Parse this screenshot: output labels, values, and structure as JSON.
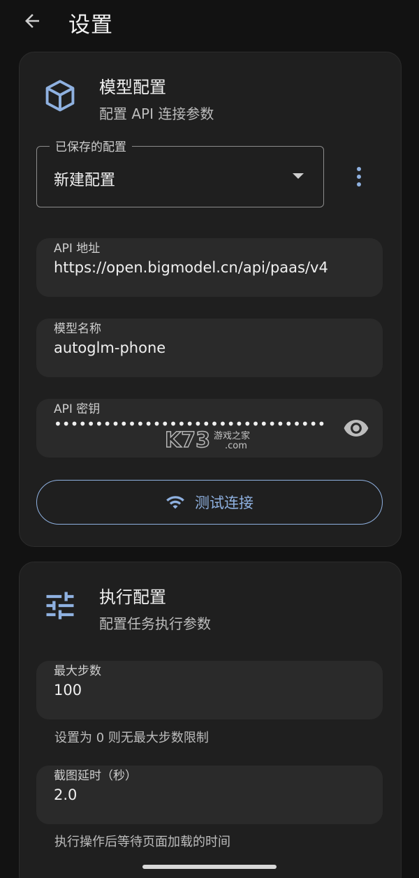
{
  "header": {
    "title": "设置"
  },
  "model_card": {
    "title": "模型配置",
    "subtitle": "配置 API 连接参数",
    "saved_config": {
      "label": "已保存的配置",
      "value": "新建配置"
    },
    "api_url": {
      "label": "API 地址",
      "value": "https://open.bigmodel.cn/api/paas/v4"
    },
    "model_name": {
      "label": "模型名称",
      "value": "autoglm-phone"
    },
    "api_key": {
      "label": "API 密钥",
      "value": "••••••••••••••••••••••••••••••••••••••••••••••••"
    },
    "test_button": {
      "label": "测试连接"
    }
  },
  "exec_card": {
    "title": "执行配置",
    "subtitle": "配置任务执行参数",
    "max_steps": {
      "label": "最大步数",
      "value": "100",
      "helper": "设置为 0 则无最大步数限制"
    },
    "screenshot_delay": {
      "label": "截图延时（秒）",
      "value": "2.0",
      "helper": "执行操作后等待页面加载的时间"
    }
  },
  "watermark": {
    "brand": "K73",
    "sub": "游戏之家",
    "domain": ".com"
  },
  "colors": {
    "accent": "#8fb1e0",
    "background": "#121212",
    "card": "#1f1f1f",
    "field": "#2a2a2a"
  }
}
